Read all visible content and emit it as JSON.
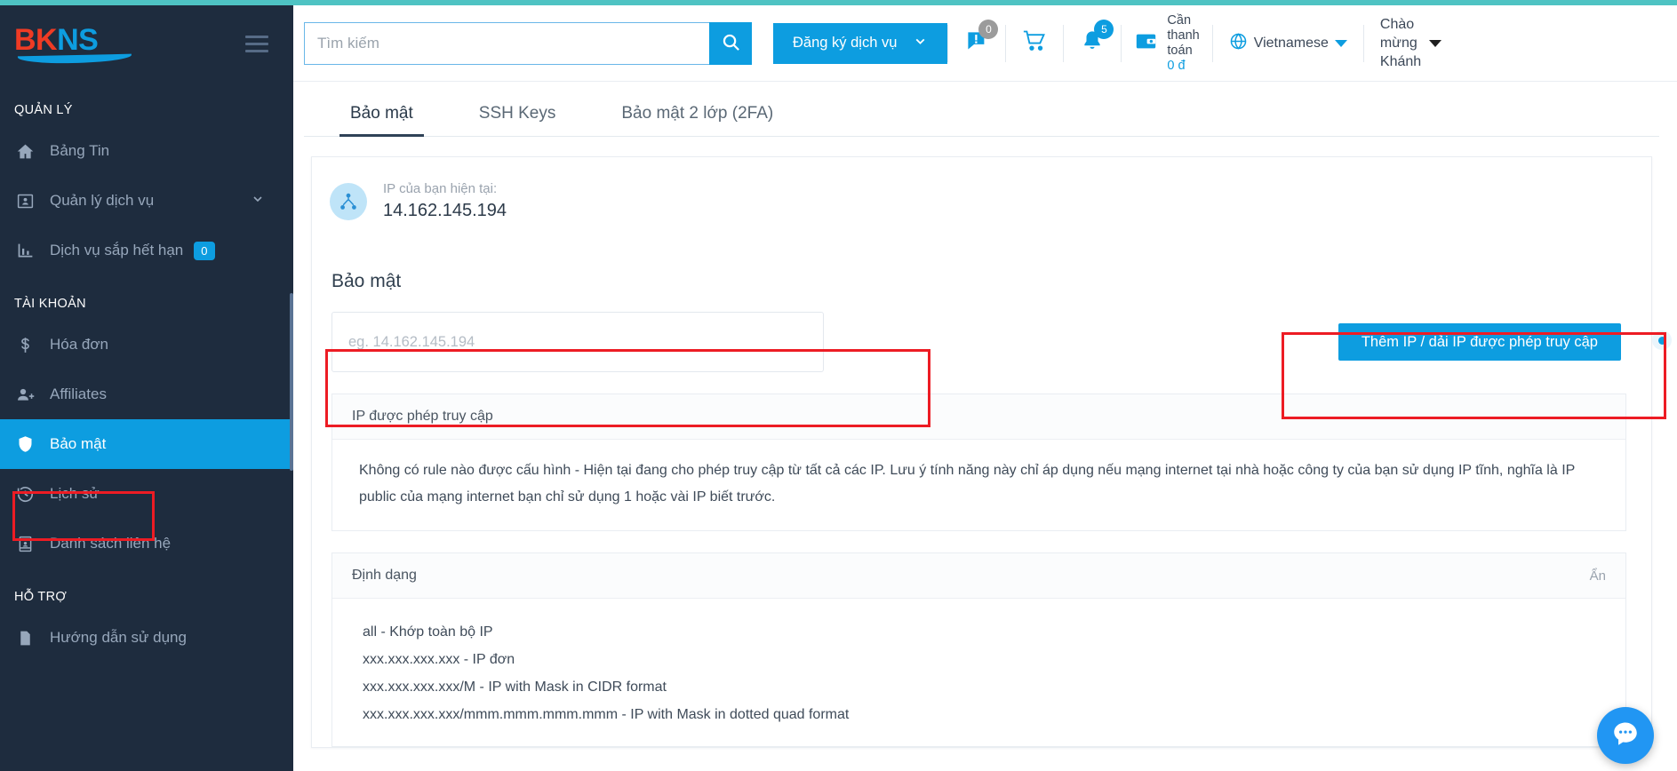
{
  "brand": {
    "name_part1": "BK",
    "name_part2": "NS",
    "menu_icon": "hamburger-icon"
  },
  "sidebar": {
    "sections": [
      {
        "heading": "QUẢN LÝ",
        "items": [
          {
            "label": "Bảng Tin",
            "icon": "home-icon"
          },
          {
            "label": "Quản lý dịch vụ",
            "icon": "service-card-icon",
            "chevron": true
          },
          {
            "label": "Dịch vụ sắp hết hạn",
            "icon": "bar-chart-icon",
            "badge": "0"
          }
        ]
      },
      {
        "heading": "TÀI KHOẢN",
        "items": [
          {
            "label": "Hóa đơn",
            "icon": "dollar-icon"
          },
          {
            "label": "Affiliates",
            "icon": "user-plus-icon"
          },
          {
            "label": "Bảo mật",
            "icon": "shield-icon",
            "active": true
          },
          {
            "label": "Lịch sử",
            "icon": "history-clock-icon"
          },
          {
            "label": "Danh sách liên hệ",
            "icon": "contact-card-icon"
          }
        ]
      },
      {
        "heading": "HỖ TRỢ",
        "items": [
          {
            "label": "Hướng dẫn sử dụng",
            "icon": "document-icon"
          }
        ]
      }
    ]
  },
  "header": {
    "search_placeholder": "Tìm kiếm",
    "search_value": "",
    "search_button_icon": "search-icon",
    "register_button": "Đăng ký dịch vụ",
    "messages": {
      "icon": "message-alert-icon",
      "badge": "0"
    },
    "cart": {
      "icon": "cart-icon"
    },
    "notifications": {
      "icon": "bell-icon",
      "badge": "5"
    },
    "wallet": {
      "icon": "wallet-icon",
      "label_line1": "Cần",
      "label_line2": "thanh",
      "label_line3": "toán",
      "amount": "0 đ"
    },
    "language": {
      "icon": "globe-icon",
      "label": "Vietnamese"
    },
    "user": {
      "line1": "Chào",
      "line2": "mừng",
      "line3": "Khánh"
    }
  },
  "tabs": [
    {
      "label": "Bảo mật",
      "active": true
    },
    {
      "label": "SSH Keys",
      "active": false
    },
    {
      "label": "Bảo mật 2 lớp (2FA)",
      "active": false
    }
  ],
  "ip_card": {
    "icon": "sitemap-icon",
    "label": "IP của bạn hiện tại:",
    "value": "14.162.145.194"
  },
  "security": {
    "section_title": "Bảo mật",
    "ip_input_placeholder": "eg. 14.162.145.194",
    "ip_input_value": "",
    "add_button": "Thêm IP / dải IP được phép truy cập"
  },
  "allowed_card": {
    "title": "IP được phép truy cập",
    "body": "Không có rule nào được cấu hình - Hiện tại đang cho phép truy cập từ tất cả các IP. Lưu ý tính năng này chỉ áp dụng nếu mạng internet tại nhà hoặc công ty của bạn sử dụng IP tĩnh, nghĩa là IP public của mạng internet bạn chỉ sử dụng 1 hoặc vài IP biết trước."
  },
  "format_card": {
    "title": "Định dạng",
    "hide_label": "Ẩn",
    "lines": [
      "all - Khớp toàn bộ IP",
      "xxx.xxx.xxx.xxx - IP đơn",
      "xxx.xxx.xxx.xxx/M - IP with Mask in CIDR format",
      "xxx.xxx.xxx.xxx/mmm.mmm.mmm.mmm - IP with Mask in dotted quad format"
    ]
  },
  "chat_widget": {
    "icon": "chat-dots-icon"
  },
  "colors": {
    "accent_blue": "#0d9de0",
    "sidebar_bg": "#1e2c3e",
    "top_accent": "#4ec3c3",
    "annotation_red": "#ed1c24",
    "logo_red": "#ef3b24"
  }
}
